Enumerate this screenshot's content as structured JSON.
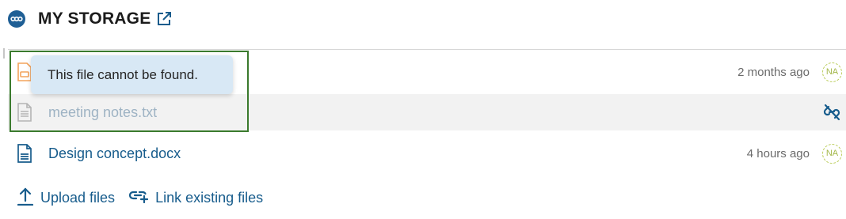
{
  "header": {
    "title": "MY STORAGE",
    "logo_icon": "nextcloud-logo-icon",
    "external_link_icon": "external-link-icon"
  },
  "files": [
    {
      "name": "",
      "time": "2 months ago",
      "avatar": "NA",
      "icon": "file-orange-icon"
    },
    {
      "name": "meeting notes.txt",
      "time": "",
      "avatar": "",
      "icon": "text-file-icon",
      "status_icon": "unlink-icon"
    },
    {
      "name": "Design concept.docx",
      "time": "4 hours ago",
      "avatar": "NA",
      "icon": "document-icon"
    }
  ],
  "tooltip": {
    "text": "This file cannot be found."
  },
  "actions": {
    "upload_label": "Upload files",
    "link_label": "Link existing files"
  },
  "colors": {
    "accent": "#175c8c",
    "focus_border": "#3a7a2d",
    "tooltip_bg": "#d8e8f5",
    "avatar": "#a3b74a"
  }
}
